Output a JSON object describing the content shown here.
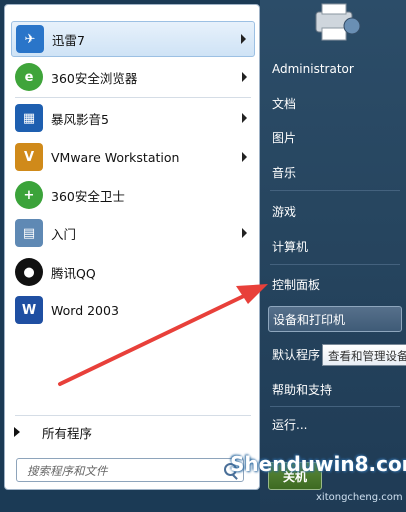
{
  "programs": [
    {
      "label": "迅雷7",
      "icon": "xunlei-bird-icon",
      "color": "#2a75c9"
    },
    {
      "label": "360安全浏览器",
      "icon": "360-browser-icon",
      "color": "#3fa43a"
    },
    {
      "label": "暴风影音5",
      "icon": "baofeng-film-icon",
      "color": "#1e5fb0"
    },
    {
      "label": "VMware Workstation",
      "icon": "vmware-icon",
      "color": "#d08a1a"
    },
    {
      "label": "360安全卫士",
      "icon": "360-safeguard-icon",
      "color": "#3ba33a"
    },
    {
      "label": "入门",
      "icon": "getting-started-icon",
      "color": "#5f89b4"
    },
    {
      "label": "腾讯QQ",
      "icon": "qq-penguin-icon",
      "color": "#111111"
    },
    {
      "label": "Word 2003",
      "icon": "word-icon",
      "color": "#1f4fa2"
    }
  ],
  "all_programs": "所有程序",
  "search_placeholder": "搜索程序和文件",
  "right_items": [
    "Administrator",
    "文档",
    "图片",
    "音乐",
    "游戏",
    "计算机",
    "控制面板",
    "设备和打印机",
    "默认程序",
    "帮助和支持",
    "运行..."
  ],
  "tooltip": "查看和管理设备",
  "shutdown": "关机",
  "watermark": "Shenduwin8.com",
  "watermark_sub": "xitongcheng.com",
  "colors": {
    "arrow": "#e8403a"
  }
}
